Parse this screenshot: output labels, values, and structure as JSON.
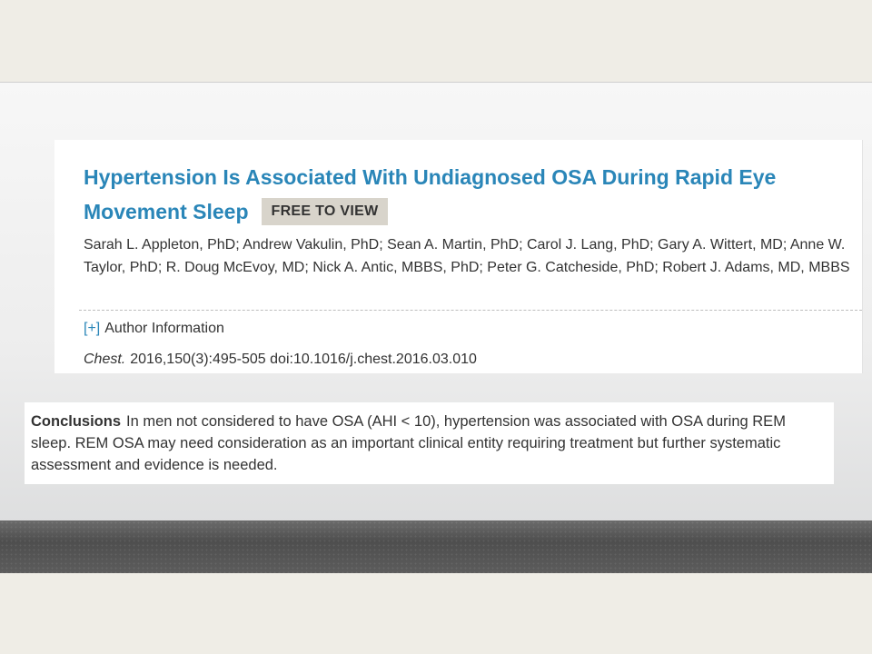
{
  "article": {
    "title": "Hypertension Is Associated With Undiagnosed OSA During Rapid Eye Movement Sleep",
    "badge": "FREE TO VIEW",
    "authors": "Sarah L. Appleton, PhD; Andrew Vakulin, PhD; Sean A. Martin, PhD; Carol J. Lang, PhD; Gary A. Wittert, MD; Anne W. Taylor, PhD; R. Doug McEvoy, MD; Nick A. Antic, MBBS, PhD; Peter G. Catcheside, PhD; Robert J. Adams, MD, MBBS",
    "author_info_toggle": "[+]",
    "author_info_label": "Author Information",
    "journal": "Chest.",
    "citation": "2016,150(3):495-505 doi:10.1016/j.chest.2016.03.010"
  },
  "conclusions": {
    "label": "Conclusions",
    "text": "In men not considered to have OSA (AHI < 10), hypertension was associated with OSA during REM sleep. REM OSA may need consideration as an important clinical entity requiring treatment but further systematic assessment and evidence is needed."
  },
  "colors": {
    "title": "#2a86b8",
    "badge_bg": "#d8d4cb",
    "page_bg": "#efede6"
  }
}
